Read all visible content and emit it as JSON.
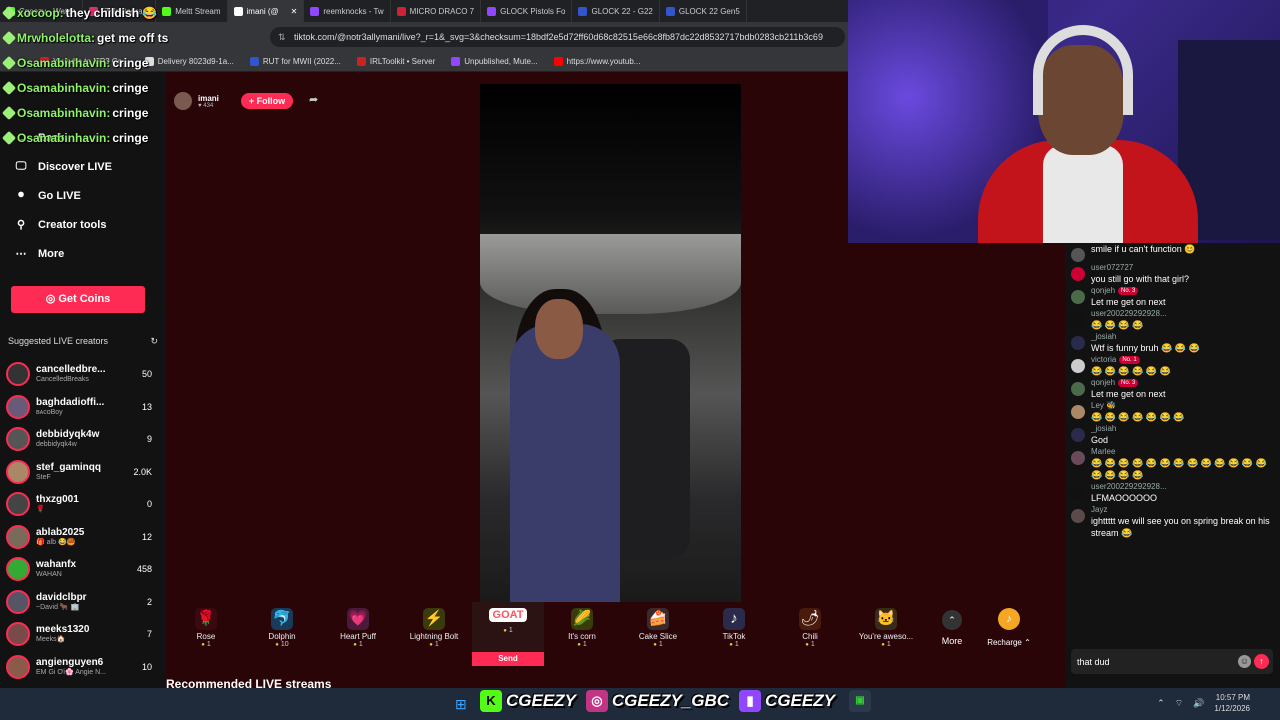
{
  "browser": {
    "tabs": [
      {
        "label": "Cgeezy - Watch",
        "color": "#53fc18"
      },
      {
        "label": "(7) Instagram",
        "color": "#e1306c"
      },
      {
        "label": "Meltt Stream",
        "color": "#53fc18"
      },
      {
        "label": "imani (@",
        "color": "#ffffff"
      },
      {
        "label": "reemknocks - Tw",
        "color": "#9146ff"
      },
      {
        "label": "MICRO DRACO 7",
        "color": "#cc2233"
      },
      {
        "label": "GLOCK Pistols Fo",
        "color": "#9146ff"
      },
      {
        "label": "GLOCK 22 - G22",
        "color": "#3355cc"
      },
      {
        "label": "GLOCK 22 Gen5",
        "color": "#3355cc"
      }
    ],
    "url": "tiktok.com/@notr3allymani/live?_r=1&_svg=3&checksum=18bdf2e5d72ff60d68c82515e66c8fb87dc22d8532717bdb0283cb211b3c69",
    "bookmarks": [
      {
        "label": "Youtube to MP3 Co...",
        "color": "#cc2222"
      },
      {
        "label": "Delivery 8023d9-1a...",
        "color": "#dddddd"
      },
      {
        "label": "RUT for MWII (2022...",
        "color": "#3355cc"
      },
      {
        "label": "IRLToolkit • Server",
        "color": "#cc2222"
      },
      {
        "label": "Unpublished, Mute...",
        "color": "#9146ff"
      },
      {
        "label": "https://www.youtub...",
        "color": "#ff0000"
      }
    ]
  },
  "overlay_chat": [
    {
      "user": "xocoop:",
      "text": "they childish 😂"
    },
    {
      "user": "Mrwholelotta:",
      "text": "get me off ts"
    },
    {
      "user": "Osamabinhavin:",
      "text": "cringe"
    },
    {
      "user": "Osamabinhavin:",
      "text": "cringe"
    },
    {
      "user": "Osamabinhavin:",
      "text": "cringe"
    },
    {
      "user": "Osamabinhavin:",
      "text": "cringe"
    }
  ],
  "sidebar": {
    "back": "Back",
    "nav": [
      {
        "label": "Discover LIVE",
        "icon": "🖵"
      },
      {
        "label": "Go LIVE",
        "icon": "⏺"
      },
      {
        "label": "Creator tools",
        "icon": "⚲"
      },
      {
        "label": "More",
        "icon": "⋯"
      }
    ],
    "get_coins": "Get Coins",
    "suggested_title": "Suggested LIVE creators",
    "creators": [
      {
        "name": "cancelledbre...",
        "sub": "CancelledBreaks",
        "count": "50"
      },
      {
        "name": "baghdadioffi...",
        "sub": "ʙᴀᴄoBoy",
        "count": "13"
      },
      {
        "name": "debbidyqk4w",
        "sub": "debbidyqk4w",
        "count": "9"
      },
      {
        "name": "stef_gaminqq",
        "sub": "SteF",
        "count": "2.0K"
      },
      {
        "name": "thxzg001",
        "sub": "🌹",
        "count": "0"
      },
      {
        "name": "ablab2025",
        "sub": "🎁 alb 😂🥮",
        "count": "12"
      },
      {
        "name": "wahanfx",
        "sub": "WAHAN",
        "count": "458"
      },
      {
        "name": "davidclbpr",
        "sub": "~David 🐂 🏢",
        "count": "2"
      },
      {
        "name": "meeks1320",
        "sub": "Meeks🏠",
        "count": "7"
      },
      {
        "name": "angienguyen6",
        "sub": "EM Gi Ơi🌸 Angie N...",
        "count": "10"
      }
    ]
  },
  "stream": {
    "streamer": "imani",
    "viewers": "434",
    "follow": "+ Follow"
  },
  "gifts": [
    {
      "name": "Rose",
      "price": "1",
      "icon": "🌹",
      "bg": "#3a0a10"
    },
    {
      "name": "Dolphin",
      "price": "10",
      "icon": "🐬",
      "bg": "#1a3a5a"
    },
    {
      "name": "Heart Puff",
      "price": "1",
      "icon": "💗",
      "bg": "#4a1a3a"
    },
    {
      "name": "Lightning Bolt",
      "price": "1",
      "icon": "⚡",
      "bg": "#3a3a0a"
    }
  ],
  "goat": {
    "label": "GOAT",
    "price": "1",
    "send": "Send"
  },
  "gifts2": [
    {
      "name": "It's corn",
      "price": "1",
      "icon": "🌽",
      "bg": "#3a3a0a"
    },
    {
      "name": "Cake Slice",
      "price": "1",
      "icon": "🍰",
      "bg": "#3a2a2a"
    },
    {
      "name": "TikTok",
      "price": "1",
      "icon": "♪",
      "bg": "#2a2a4a"
    },
    {
      "name": "Chili",
      "price": "1",
      "icon": "🌶",
      "bg": "#4a1a0a"
    },
    {
      "name": "You're aweso...",
      "price": "1",
      "icon": "🐱",
      "bg": "#3a2a1a"
    }
  ],
  "more_label": "More",
  "recharge_label": "Recharge ⌃",
  "recommended": "Recommended LIVE streams",
  "chat": [
    {
      "user": "",
      "badge": "",
      "text": "smile if u can't function 😊",
      "color": "#555"
    },
    {
      "user": "user072727",
      "badge": "",
      "text": "you still go with that girl?",
      "color": "#c03"
    },
    {
      "user": "qonjeh",
      "badge": "No. 3",
      "text": "Let me get on next",
      "color": "#4a6a4a"
    },
    {
      "user": "user200229292928...",
      "badge": "",
      "text": "😂 😂 😂 😂",
      "color": "#111"
    },
    {
      "user": "_josiah",
      "badge": "",
      "text": "Wtf is funny bruh 😂 😂 😂",
      "color": "#2a2a4a"
    },
    {
      "user": "victoria",
      "badge": "No. 1",
      "text": "😂 😂 😂 😂 😂 😂",
      "color": "#ccc"
    },
    {
      "user": "qonjeh",
      "badge": "No. 3",
      "text": "Let me get on next",
      "color": "#4a6a4a"
    },
    {
      "user": "Ley 🐝",
      "badge": "",
      "text": "😂 😂 😂 😂 😂 😂 😂",
      "color": "#aa8866"
    },
    {
      "user": "_josiah",
      "badge": "",
      "text": "God",
      "color": "#2a2a4a"
    },
    {
      "user": "Marlee",
      "badge": "",
      "text": "😂 😂 😂 😂 😂 😂 😂 😂 😂 😂 😂 😂 😂 😂 😂 😂 😂",
      "color": "#6a4a5a"
    },
    {
      "user": "user200229292928...",
      "badge": "",
      "text": "LFMAOOOOOO",
      "color": "#111"
    },
    {
      "user": "Jayz",
      "badge": "",
      "text": "ighttttt we will see you on spring break on his stream 😂",
      "color": "#5a4a4a"
    }
  ],
  "chat_input": "that dud",
  "taskbar": {
    "kick": "CGEEZY",
    "instagram": "CGEEZY_GBC",
    "twitch": "CGEEZY",
    "time": "10:57 PM",
    "date": "1/12/2026"
  }
}
